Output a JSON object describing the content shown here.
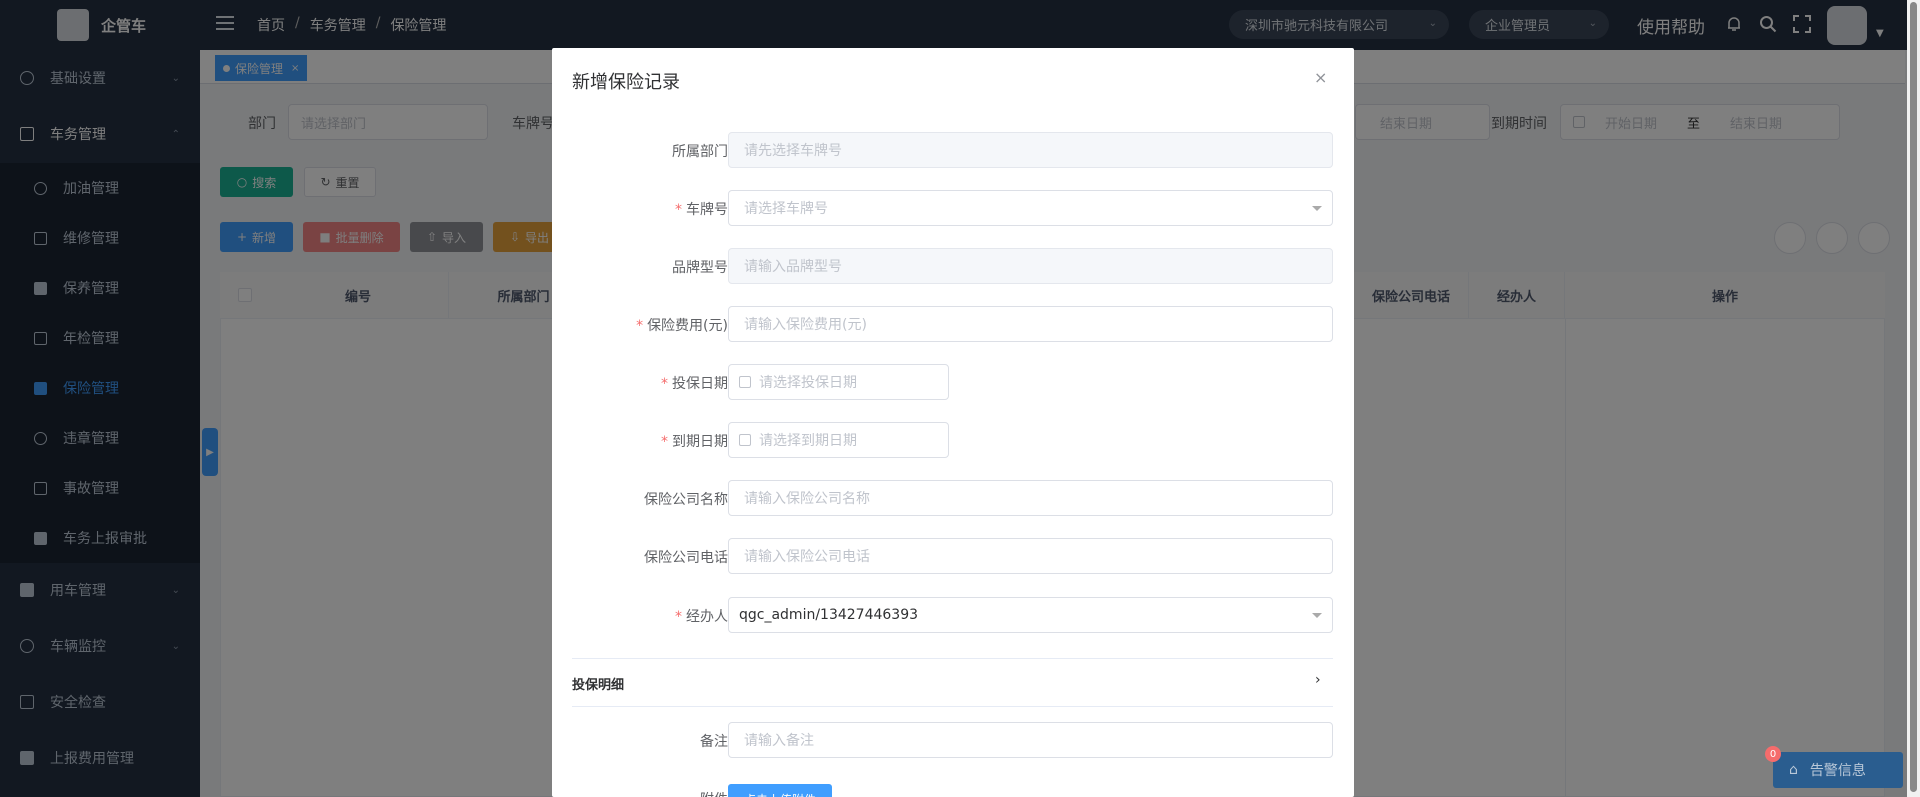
{
  "app": {
    "name": "企管车"
  },
  "sidebar": {
    "items": [
      {
        "label": "基础设置"
      },
      {
        "label": "车务管理"
      },
      {
        "label": "用车管理"
      },
      {
        "label": "车辆监控"
      },
      {
        "label": "安全检查"
      },
      {
        "label": "上报费用管理"
      }
    ],
    "subitems": [
      {
        "label": "加油管理"
      },
      {
        "label": "维修管理"
      },
      {
        "label": "保养管理"
      },
      {
        "label": "年检管理"
      },
      {
        "label": "保险管理"
      },
      {
        "label": "违章管理"
      },
      {
        "label": "事故管理"
      },
      {
        "label": "车务上报审批"
      }
    ],
    "expand_handle": "▶"
  },
  "header": {
    "breadcrumb": [
      "首页",
      "/",
      "车务管理",
      "/",
      "保险管理"
    ],
    "company": "深圳市驰元科技有限公司",
    "role": "企业管理员",
    "help": "使用帮助"
  },
  "tags": {
    "active": "保险管理",
    "close": "×"
  },
  "filters": {
    "dept_label": "部门",
    "dept_placeholder": "请选择部门",
    "plate_label": "车牌号",
    "end_date_placeholder": "结束日期",
    "expire_label": "到期时间",
    "start_placeholder": "开始日期",
    "range_sep": "至",
    "end_placeholder": "结束日期"
  },
  "toolbar": {
    "search": "搜索",
    "reset": "重置",
    "add": "新增",
    "batch_delete": "批量删除",
    "import": "导入",
    "export": "导出"
  },
  "table": {
    "columns": [
      "编号",
      "所属部门",
      "保险公司电话",
      "经办人",
      "操作"
    ]
  },
  "dialog": {
    "title": "新增保险记录",
    "close": "×",
    "fields": {
      "dept": {
        "label": "所属部门",
        "placeholder": "请先选择车牌号"
      },
      "plate": {
        "label": "车牌号",
        "placeholder": "请选择车牌号"
      },
      "model": {
        "label": "品牌型号",
        "placeholder": "请输入品牌型号"
      },
      "fee": {
        "label": "保险费用(元)",
        "placeholder": "请输入保险费用(元)"
      },
      "insure_date": {
        "label": "投保日期",
        "placeholder": "请选择投保日期"
      },
      "expire_date": {
        "label": "到期日期",
        "placeholder": "请选择到期日期"
      },
      "company": {
        "label": "保险公司名称",
        "placeholder": "请输入保险公司名称"
      },
      "phone": {
        "label": "保险公司电话",
        "placeholder": "请输入保险公司电话"
      },
      "handler": {
        "label": "经办人",
        "value": "qgc_admin/13427446393"
      },
      "remark": {
        "label": "备注",
        "placeholder": "请输入备注"
      },
      "attachment": {
        "label": "附件",
        "button": "点击上传附件"
      }
    },
    "section": {
      "title": "投保明细",
      "arrow": "›"
    },
    "required_mark": "*"
  },
  "alert": {
    "label": "告警信息",
    "count": "0"
  },
  "colors": {
    "primary": "#409eff",
    "sidebar_bg": "#243042",
    "danger": "#f56c6c"
  }
}
